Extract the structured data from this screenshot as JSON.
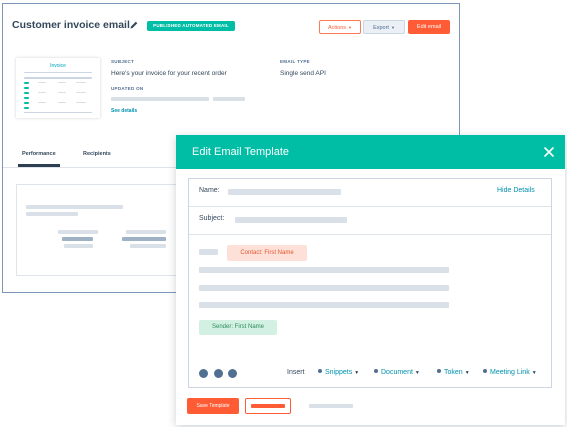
{
  "page": {
    "title": "Customer invoice email",
    "status_badge": "PUBLISHED AUTOMATED EMAIL",
    "actions_label": "Actions",
    "export_label": "Export",
    "edit_label": "Edit email"
  },
  "thumbnail": {
    "title": "Invoice"
  },
  "details": {
    "subject_label": "SUBJECT",
    "subject_value": "Here's your invoice for your recent order",
    "updated_label": "UPDATED ON",
    "see_details": "See details",
    "email_type_label": "EMAIL TYPE",
    "email_type_value": "Single send API"
  },
  "tabs": [
    "Performance",
    "Recipients"
  ],
  "modal": {
    "title": "Edit Email Template",
    "name_label": "Name:",
    "hide_details": "Hide Details",
    "subject_label": "Subject:",
    "contact_token": "Contact: First Name",
    "sender_token": "Sender: First Name",
    "insert_label": "Insert",
    "insert_items": [
      "Snippets",
      "Document",
      "Token",
      "Meeting Link"
    ],
    "save_label": "Save Template"
  },
  "colors": {
    "teal": "#00bda5",
    "orange": "#ff5c35",
    "link": "#0091ae",
    "dark_text": "#33475b"
  },
  "icons": [
    "pencil-icon",
    "close-icon",
    "caret-down-icon"
  ]
}
